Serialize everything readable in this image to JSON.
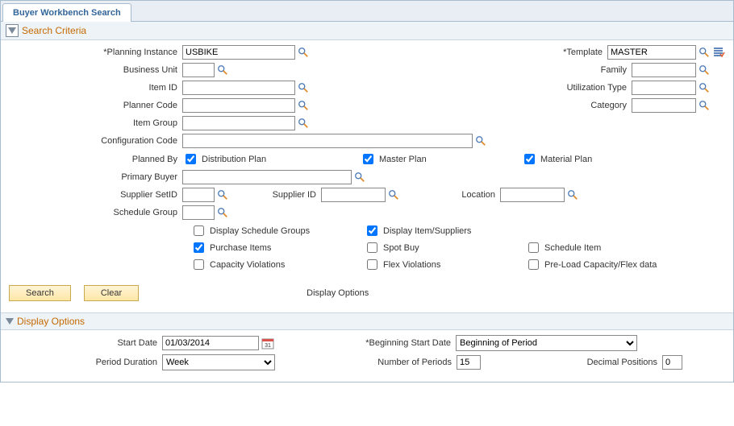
{
  "tab": {
    "title": "Buyer Workbench Search"
  },
  "search_criteria": {
    "title": "Search Criteria",
    "planning_instance": {
      "label": "*Planning Instance",
      "value": "USBIKE"
    },
    "template": {
      "label": "*Template",
      "value": "MASTER"
    },
    "business_unit": {
      "label": "Business Unit",
      "value": ""
    },
    "family": {
      "label": "Family",
      "value": ""
    },
    "item_id": {
      "label": "Item ID",
      "value": ""
    },
    "utilization_type": {
      "label": "Utilization Type",
      "value": ""
    },
    "planner_code": {
      "label": "Planner Code",
      "value": ""
    },
    "category": {
      "label": "Category",
      "value": ""
    },
    "item_group": {
      "label": "Item Group",
      "value": ""
    },
    "configuration_code": {
      "label": "Configuration Code",
      "value": ""
    },
    "planned_by": {
      "label": "Planned By",
      "distribution_plan": "Distribution Plan",
      "master_plan": "Master Plan",
      "material_plan": "Material Plan"
    },
    "primary_buyer": {
      "label": "Primary Buyer",
      "value": ""
    },
    "supplier_setid": {
      "label": "Supplier SetID",
      "value": ""
    },
    "supplier_id": {
      "label": "Supplier ID",
      "value": ""
    },
    "location": {
      "label": "Location",
      "value": ""
    },
    "schedule_group": {
      "label": "Schedule Group",
      "value": ""
    },
    "checkboxes": {
      "display_schedule_groups": "Display Schedule Groups",
      "display_item_suppliers": "Display Item/Suppliers",
      "purchase_items": "Purchase Items",
      "spot_buy": "Spot Buy",
      "schedule_item": "Schedule Item",
      "capacity_violations": "Capacity Violations",
      "flex_violations": "Flex Violations",
      "preload": "Pre-Load Capacity/Flex data"
    },
    "buttons": {
      "search": "Search",
      "clear": "Clear",
      "display_options_link": "Display Options"
    }
  },
  "display_options": {
    "title": "Display Options",
    "start_date": {
      "label": "Start Date",
      "value": "01/03/2014"
    },
    "beginning_start_date": {
      "label": "*Beginning Start Date",
      "value": "Beginning of Period"
    },
    "period_duration": {
      "label": "Period Duration",
      "value": "Week"
    },
    "number_of_periods": {
      "label": "Number of Periods",
      "value": "15"
    },
    "decimal_positions": {
      "label": "Decimal Positions",
      "value": "0"
    }
  }
}
